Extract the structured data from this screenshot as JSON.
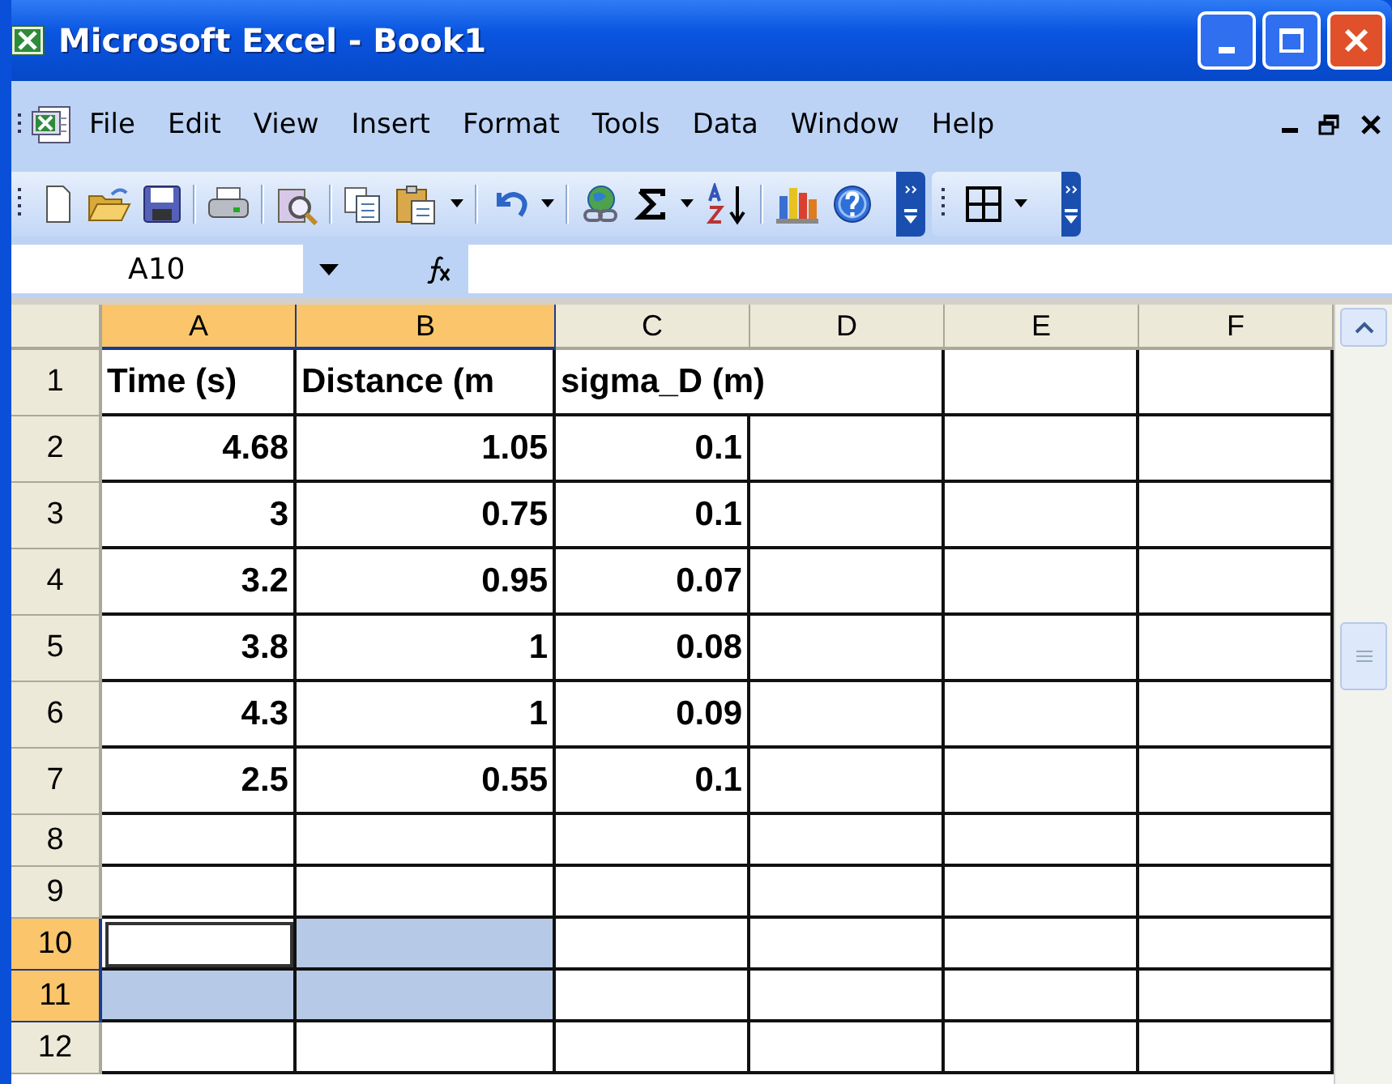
{
  "window": {
    "title": "Microsoft Excel - Book1"
  },
  "menu": [
    {
      "label": "File"
    },
    {
      "label": "Edit"
    },
    {
      "label": "View"
    },
    {
      "label": "Insert"
    },
    {
      "label": "Format"
    },
    {
      "label": "Tools"
    },
    {
      "label": "Data"
    },
    {
      "label": "Window"
    },
    {
      "label": "Help"
    }
  ],
  "formula_bar": {
    "name_box": "A10"
  },
  "columns": [
    {
      "label": "A",
      "selected": true
    },
    {
      "label": "B",
      "selected": true
    },
    {
      "label": "C",
      "selected": false
    },
    {
      "label": "D",
      "selected": false
    },
    {
      "label": "E",
      "selected": false
    },
    {
      "label": "F",
      "selected": false
    }
  ],
  "rows": [
    {
      "label": "1",
      "selected": false,
      "cells": [
        {
          "text": "Time (s)",
          "kind": "text"
        },
        {
          "text": "Distance (m",
          "kind": "text"
        },
        {
          "text": "sigma_D (m)",
          "kind": "text"
        }
      ]
    },
    {
      "label": "2",
      "selected": false,
      "cells": [
        {
          "text": "4.68",
          "kind": "number"
        },
        {
          "text": "1.05",
          "kind": "number"
        },
        {
          "text": "0.1",
          "kind": "number"
        }
      ]
    },
    {
      "label": "3",
      "selected": false,
      "cells": [
        {
          "text": "3",
          "kind": "number"
        },
        {
          "text": "0.75",
          "kind": "number"
        },
        {
          "text": "0.1",
          "kind": "number"
        }
      ]
    },
    {
      "label": "4",
      "selected": false,
      "cells": [
        {
          "text": "3.2",
          "kind": "number"
        },
        {
          "text": "0.95",
          "kind": "number"
        },
        {
          "text": "0.07",
          "kind": "number"
        }
      ]
    },
    {
      "label": "5",
      "selected": false,
      "cells": [
        {
          "text": "3.8",
          "kind": "number"
        },
        {
          "text": "1",
          "kind": "number"
        },
        {
          "text": "0.08",
          "kind": "number"
        }
      ]
    },
    {
      "label": "6",
      "selected": false,
      "cells": [
        {
          "text": "4.3",
          "kind": "number"
        },
        {
          "text": "1",
          "kind": "number"
        },
        {
          "text": "0.09",
          "kind": "number"
        }
      ]
    },
    {
      "label": "7",
      "selected": false,
      "cells": [
        {
          "text": "2.5",
          "kind": "number"
        },
        {
          "text": "0.55",
          "kind": "number"
        },
        {
          "text": "0.1",
          "kind": "number"
        }
      ]
    },
    {
      "label": "8",
      "selected": false
    },
    {
      "label": "9",
      "selected": false
    },
    {
      "label": "10",
      "selected": true,
      "cells": [
        {
          "selected": true,
          "active": true
        },
        {
          "selected": true,
          "active": false
        }
      ]
    },
    {
      "label": "11",
      "selected": true,
      "cells": [
        {
          "selected": true,
          "active": false
        },
        {
          "selected": true,
          "active": false
        }
      ]
    },
    {
      "label": "12",
      "selected": false
    }
  ]
}
